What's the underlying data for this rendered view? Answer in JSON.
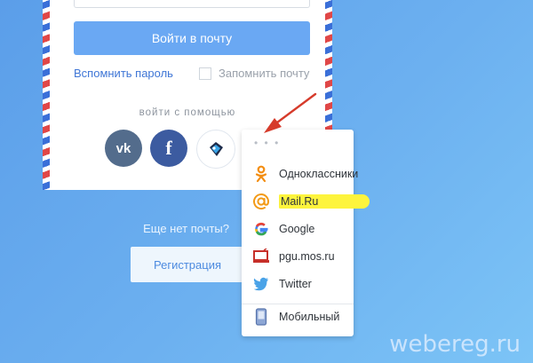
{
  "login": {
    "button_label": "Войти в почту",
    "forgot_password": "Вспомнить пароль",
    "remember_label": "Запомнить почту",
    "login_with": "войти с помощью"
  },
  "social": {
    "vk_label": "vk",
    "fb_label": "f"
  },
  "signup": {
    "prompt": "Еще нет почты?",
    "register_label": "Регистрация"
  },
  "providers": {
    "more": "• • •",
    "items": [
      {
        "label": "Одноклассники",
        "icon": "odnoklassniki-icon"
      },
      {
        "label": "Mail.Ru",
        "icon": "mailru-at-icon"
      },
      {
        "label": "Google",
        "icon": "google-icon"
      },
      {
        "label": "pgu.mos.ru",
        "icon": "pgu-mos-ru-icon"
      },
      {
        "label": "Twitter",
        "icon": "twitter-icon"
      },
      {
        "label": "Мобильный",
        "icon": "mobile-phone-icon"
      }
    ]
  },
  "colors": {
    "login_button": "#6aa8f3",
    "highlight": "#fdf43d",
    "arrow": "#d63b2b"
  },
  "watermark": "webereg.ru"
}
